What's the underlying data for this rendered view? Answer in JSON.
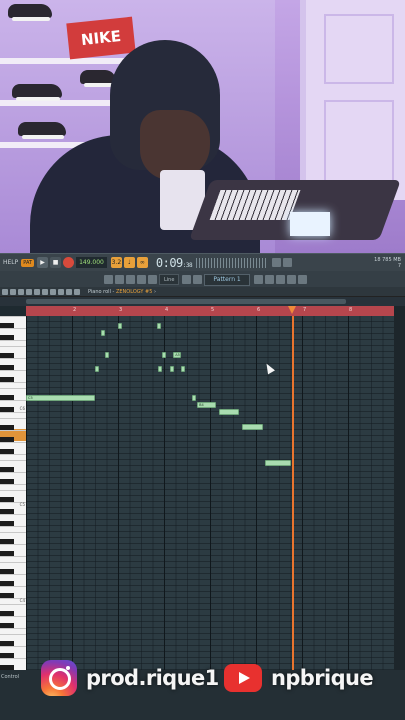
{
  "webcam": {
    "shoebox_text": "NIKE"
  },
  "toolbar": {
    "help": "HELP",
    "pat_badge": "PAT",
    "tempo": "149.000",
    "time": "0:09",
    "time_sub": ":38",
    "counter_a": "3.2",
    "cpu_line1": "18  785 MB",
    "cpu_line2": "7",
    "snap": "Line",
    "pattern": "Pattern 1"
  },
  "piano_roll": {
    "title_prefix": "Piano roll - ",
    "instrument": "ZENOLOGY #5",
    "title_suffix": " ›",
    "bars": [
      "2",
      "3",
      "4",
      "5",
      "6",
      "7",
      "8"
    ],
    "octave_labels": [
      "C6",
      "C5",
      "C4"
    ],
    "notes": [
      {
        "label": "",
        "bar": 2.64,
        "len": 0.07,
        "row": 0
      },
      {
        "label": "",
        "bar": 3.0,
        "len": 0.06,
        "row": -1
      },
      {
        "label": "",
        "bar": 3.85,
        "len": 0.08,
        "row": -1
      },
      {
        "label": "",
        "bar": 2.72,
        "len": 0.08,
        "row": 3
      },
      {
        "label": "",
        "bar": 3.95,
        "len": 0.08,
        "row": 3
      },
      {
        "label": "A5",
        "bar": 4.2,
        "len": 0.18,
        "row": 3
      },
      {
        "label": "",
        "bar": 2.5,
        "len": 0.09,
        "row": 5
      },
      {
        "label": "",
        "bar": 3.88,
        "len": 0.05,
        "row": 5
      },
      {
        "label": "",
        "bar": 4.14,
        "len": 0.08,
        "row": 5
      },
      {
        "label": "",
        "bar": 4.37,
        "len": 0.07,
        "row": 5
      },
      {
        "label": "C5",
        "bar": 1.0,
        "len": 1.5,
        "row": 9
      },
      {
        "label": "",
        "bar": 4.6,
        "len": 0.1,
        "row": 9
      },
      {
        "label": "B4",
        "bar": 4.72,
        "len": 0.42,
        "row": 10
      },
      {
        "label": "",
        "bar": 5.19,
        "len": 0.45,
        "row": 11
      },
      {
        "label": "",
        "bar": 5.7,
        "len": 0.45,
        "row": 13
      },
      {
        "label": "",
        "bar": 6.2,
        "len": 0.56,
        "row": 18
      }
    ]
  },
  "control": {
    "label": "Control"
  },
  "social": {
    "instagram": "prod.rique1",
    "youtube": "npbrique"
  }
}
